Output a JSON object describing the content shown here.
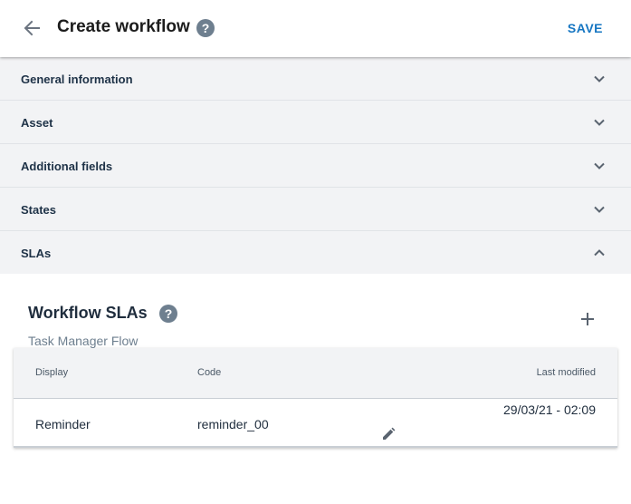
{
  "header": {
    "title": "Create workflow",
    "help_symbol": "?",
    "save_label": "SAVE"
  },
  "panels": [
    {
      "label": "General information",
      "state": "collapsed"
    },
    {
      "label": "Asset",
      "state": "collapsed"
    },
    {
      "label": "Additional fields",
      "state": "collapsed"
    },
    {
      "label": "States",
      "state": "collapsed"
    },
    {
      "label": "SLAs",
      "state": "expanded"
    }
  ],
  "sla_section": {
    "title": "Workflow SLAs",
    "help_symbol": "?",
    "subtitle": "Task Manager Flow",
    "table": {
      "columns": [
        "Display",
        "Code",
        "Last modified"
      ],
      "rows": [
        {
          "display": "Reminder",
          "code": "reminder_00",
          "last_modified": "29/03/21 - 02:09"
        }
      ]
    }
  },
  "icons": {
    "back": "arrow-left-icon",
    "help": "question-circle-icon",
    "expand": "chevron-down-icon",
    "collapse": "chevron-up-icon",
    "add": "plus-icon",
    "edit": "pencil-icon"
  },
  "colors": {
    "accent": "#1676c2",
    "panel_bg": "#f2f3f5",
    "help_icon": "#6e7f8f"
  }
}
